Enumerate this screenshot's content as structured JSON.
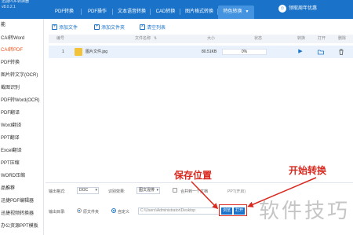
{
  "app": {
    "title": "迅捷PDF转换器",
    "version": "v8.0.2.1"
  },
  "nav": {
    "tabs": [
      {
        "label": "PDF转换"
      },
      {
        "label": "PDF操作"
      },
      {
        "label": "文本语音转换"
      },
      {
        "label": "CAD转换"
      },
      {
        "label": "图片格式转换"
      },
      {
        "label": "特色转换",
        "active": true
      }
    ],
    "vip_label": "领取周年优惠"
  },
  "sidebar": {
    "items": [
      {
        "label": "能",
        "type": "header"
      },
      {
        "label": "CAI转Word"
      },
      {
        "label": "CAI转PDF",
        "active": true
      },
      {
        "label": "PDF转换"
      },
      {
        "label": "图片转文字(OCR)"
      },
      {
        "label": "截图识别"
      },
      {
        "label": "PDF转Word(OCR)"
      },
      {
        "label": "PDF翻译"
      },
      {
        "label": "Word翻译"
      },
      {
        "label": "PPT翻译"
      },
      {
        "label": "Excel翻译"
      },
      {
        "label": "PPT压缩"
      },
      {
        "label": "WORD压缩"
      },
      {
        "label": "品推荐",
        "type": "header"
      },
      {
        "label": "迅捷PDF编辑器"
      },
      {
        "label": "迅捷视频转换器"
      },
      {
        "label": "办公资源PPT模板"
      }
    ]
  },
  "toolbar": {
    "add_file": "添加文件",
    "add_folder": "添加文件夹",
    "clear_list": "清空列表"
  },
  "table": {
    "headers": [
      "编号",
      "文件名称",
      "大小",
      "状态",
      "转换",
      "打开",
      "删除"
    ],
    "rows": [
      {
        "index": "1",
        "name": "图片文件.jpg",
        "size": "80.51KB",
        "progress_text": "0%",
        "progress": 0
      }
    ]
  },
  "settings": {
    "output_format_label": "输出格式:",
    "output_format_value": "DOC",
    "recognize_effect_label": "识别效果:",
    "recognize_effect_value": "图文混排",
    "merge_label": "合并到一个文档",
    "ppt_label": "PPT(开启)",
    "output_dir_label": "输出目录:",
    "original_folder_label": "原文件夹",
    "custom_label": "自定义",
    "path_value": "C:\\Users\\Administrator\\Desktop",
    "browse_label": "浏览",
    "open_label": "打开"
  },
  "annotations": {
    "save_location": "保存位置",
    "start_convert": "开始转换",
    "color": "#d9281e"
  },
  "watermark": "软件技巧",
  "colors": {
    "brand": "#1a73c9",
    "accent": "#e8541e"
  }
}
